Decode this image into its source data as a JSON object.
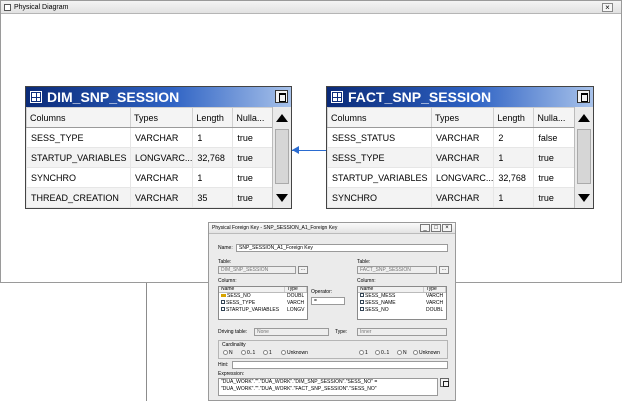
{
  "window": {
    "title": "Physical Diagram",
    "close_label": "×"
  },
  "dim_table": {
    "name": "DIM_SNP_SESSION",
    "headers": [
      "Columns",
      "Types",
      "Length",
      "Nulla..."
    ],
    "rows": [
      [
        "SESS_TYPE",
        "VARCHAR",
        "1",
        "true"
      ],
      [
        "STARTUP_VARIABLES",
        "LONGVARC...",
        "32,768",
        "true"
      ],
      [
        "SYNCHRO",
        "VARCHAR",
        "1",
        "true"
      ],
      [
        "THREAD_CREATION",
        "VARCHAR",
        "35",
        "true"
      ]
    ]
  },
  "fact_table": {
    "name": "FACT_SNP_SESSION",
    "headers": [
      "Columns",
      "Types",
      "Length",
      "Nulla..."
    ],
    "rows": [
      [
        "SESS_STATUS",
        "VARCHAR",
        "2",
        "false"
      ],
      [
        "SESS_TYPE",
        "VARCHAR",
        "1",
        "true"
      ],
      [
        "STARTUP_VARIABLES",
        "LONGVARC...",
        "32,768",
        "true"
      ],
      [
        "SYNCHRO",
        "VARCHAR",
        "1",
        "true"
      ]
    ]
  },
  "dialog": {
    "title": "Physical Foreign Key - SNP_SESSION_A1_Foreign Key",
    "win_buttons": [
      "_",
      "□",
      "×"
    ],
    "name_label": "Name:",
    "name_value": "SNP_SESSION_A1_Foreign Key",
    "table_label": "Table:",
    "table_left_value": "DIM_SNP_SESSION",
    "table_right_value": "FACT_SNP_SESSION",
    "browse_label": "...",
    "column_label": "Column:",
    "operator_label": "Operator:",
    "operator_value": "=",
    "left_columns": {
      "headers": [
        "Name",
        "Type"
      ],
      "rows": [
        [
          "SESS_NO",
          "DOUBL"
        ],
        [
          "SESS_TYPE",
          "VARCH"
        ],
        [
          "STARTUP_VARIABLES",
          "LONGV"
        ]
      ]
    },
    "right_columns": {
      "headers": [
        "Name",
        "Type"
      ],
      "rows": [
        [
          "SESS_MESS",
          "VARCH"
        ],
        [
          "SESS_NAME",
          "VARCH"
        ],
        [
          "SESS_NO",
          "DOUBL"
        ]
      ]
    },
    "driving_label": "Driving table:",
    "driving_value": "None",
    "type_label": "Type:",
    "type_value": "Inner",
    "cardinality_label": "Cardinality",
    "card_left": [
      "N",
      "0..1",
      "1",
      "Unknown"
    ],
    "card_right": [
      "1",
      "0..1",
      "N",
      "Unknown"
    ],
    "hint_label": "Hint:",
    "expression_label": "Expression:",
    "expression_line1": "\"DUA_WORK\".\"\".\"DUA_WORK\".\"DIM_SNP_SESSION\".\"SESS_NO\" =",
    "expression_line2": "\"DUA_WORK\".\"\".\"DUA_WORK\".\"FACT_SNP_SESSION\".\"SESS_NO\""
  }
}
